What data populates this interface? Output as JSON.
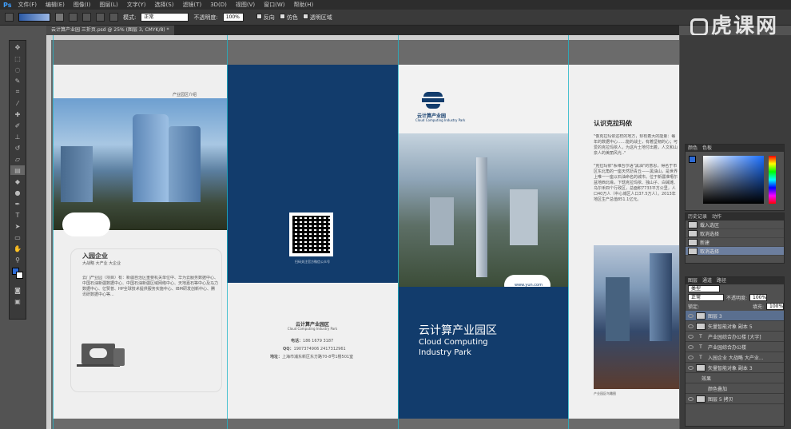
{
  "menubar": {
    "logo": "Ps",
    "items": [
      "文件(F)",
      "编辑(E)",
      "图像(I)",
      "图层(L)",
      "文字(Y)",
      "选择(S)",
      "滤镜(T)",
      "3D(D)",
      "视图(V)",
      "窗口(W)",
      "帮助(H)"
    ]
  },
  "options": {
    "mode_label": "模式:",
    "mode_value": "正常",
    "opacity_label": "不透明度:",
    "opacity_value": "100%",
    "reverse": "反向",
    "dither": "仿色",
    "transparency": "透明区域"
  },
  "document": {
    "tab": "云计算产业园 三折页.psd @ 25% (图层 3, CMYK/8) *"
  },
  "brochure": {
    "p1_header": "产业园区介绍",
    "p1_title": "入园企业",
    "p1_subtitle": "大战略 大产业 大企业",
    "p1_body": "云门产业园（项目）有：新疆自治区重要机关单位中、华为云服务数据中心、中国石油新疆数据中心、中国石油新疆区域网络中心、天地嘉石等中心及马力数据中心、亿赞普、HP全球技术提供服务实施中心、IBM研发创新中心、腾讯研数据中心等...",
    "qr_caption": "扫码关注官方微信公众号",
    "company_cn": "云计算产业园区",
    "company_en": "Cloud Computing Industry Park",
    "phone_label": "电话：",
    "phone": "186 1679 3187",
    "qq_label": "QQ：",
    "qq": "1907374906  2417312961",
    "address_label": "地址：",
    "address": "上海市浦东新区东方路70-8号1楼501室",
    "logo_cn": "云计算产业园",
    "logo_en": "Cloud Computing Industry Park",
    "url": "www.yun.com",
    "cover_cn": "云计算产业园区",
    "cover_en1": "Cloud Computing",
    "cover_en2": "Industry Park",
    "p4_title": "认识克拉玛依",
    "p4_body1": "\"像克拉玛依这样的地方，却有着大的能量：每年的数据中心……能的战士，有着坚韧的心；可爱的克拉玛依人，为这片土地付出着，人文和山泉人的美丽风光..\"",
    "p4_body2": "\"克拉玛依\"系维吾尔语\"黑油\"的意思，得名于市区东北角的一座天然沥青丘——黑油山，是世界上唯一一座以石油命名的城市。位于新疆准噶尔盆地西北缘，下辖克拉玛依、独山子、白碱滩、乌尔禾四个行政区，总面积7733平方公里，人口40万人（中心城区人口37.5万人）。2013年地区生产总值851.1亿元。",
    "p4_caption": "产业园区鸟瞰图"
  },
  "panels": {
    "color_tabs": [
      "颜色",
      "色板"
    ],
    "history_tabs": [
      "历史记录",
      "动作"
    ],
    "history": [
      "载入选区",
      "取消选择",
      "新建",
      "取消选择"
    ],
    "layers_tabs": [
      "图层",
      "通道",
      "路径"
    ],
    "filter": "类型",
    "blend": "正常",
    "opacity_label": "不透明度:",
    "opacity": "100%",
    "lock_label": "锁定:",
    "fill_label": "填充:",
    "fill": "100%",
    "layers": [
      "图层 3",
      "矢量智能对象 副本 5",
      "产业园综合办公楼 [大字]",
      "产业园综合办公楼",
      "入园企业 大战略 大产业...",
      "矢量智能对象 副本 3",
      "效果",
      "颜色叠加",
      "图层 5 拷贝"
    ]
  },
  "watermark": "虎课网",
  "colors": {
    "brand": "#123c6c",
    "accent": "#21b5c8",
    "selection": "#5a6f8f"
  }
}
